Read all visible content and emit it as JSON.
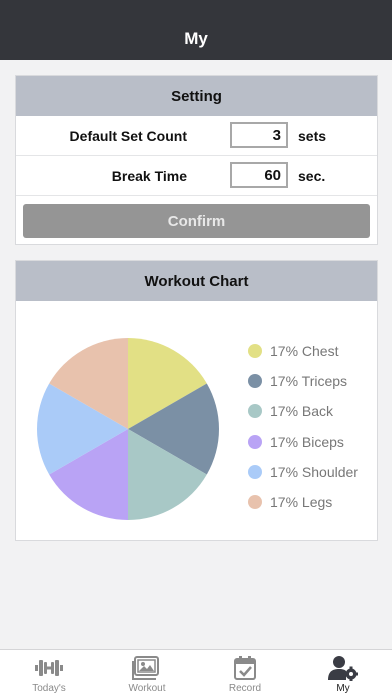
{
  "header": {
    "title": "My"
  },
  "setting": {
    "title": "Setting",
    "rows": [
      {
        "label": "Default Set Count",
        "value": "3",
        "unit": "sets"
      },
      {
        "label": "Break Time",
        "value": "60",
        "unit": "sec."
      }
    ],
    "confirm_label": "Confirm"
  },
  "workout_chart": {
    "title": "Workout Chart",
    "legend": [
      {
        "label": "17% Chest",
        "color": "#e2e085"
      },
      {
        "label": "17% Triceps",
        "color": "#7b90a5"
      },
      {
        "label": "17% Back",
        "color": "#a8c8c6"
      },
      {
        "label": "17% Biceps",
        "color": "#b9a3f5"
      },
      {
        "label": "17% Shoulder",
        "color": "#aacbf8"
      },
      {
        "label": "17% Legs",
        "color": "#e8c2ad"
      }
    ]
  },
  "chart_data": {
    "type": "pie",
    "categories": [
      "Chest",
      "Triceps",
      "Back",
      "Biceps",
      "Shoulder",
      "Legs"
    ],
    "values": [
      17,
      17,
      17,
      17,
      17,
      17
    ],
    "colors": [
      "#e2e085",
      "#7b90a5",
      "#a8c8c6",
      "#b9a3f5",
      "#aacbf8",
      "#e8c2ad"
    ],
    "legend_position": "right"
  },
  "tabbar": {
    "tabs": [
      {
        "label": "Today's",
        "icon": "dumbbell-icon"
      },
      {
        "label": "Workout",
        "icon": "gallery-icon"
      },
      {
        "label": "Record",
        "icon": "calendar-check-icon"
      },
      {
        "label": "My",
        "icon": "user-gear-icon"
      }
    ]
  }
}
